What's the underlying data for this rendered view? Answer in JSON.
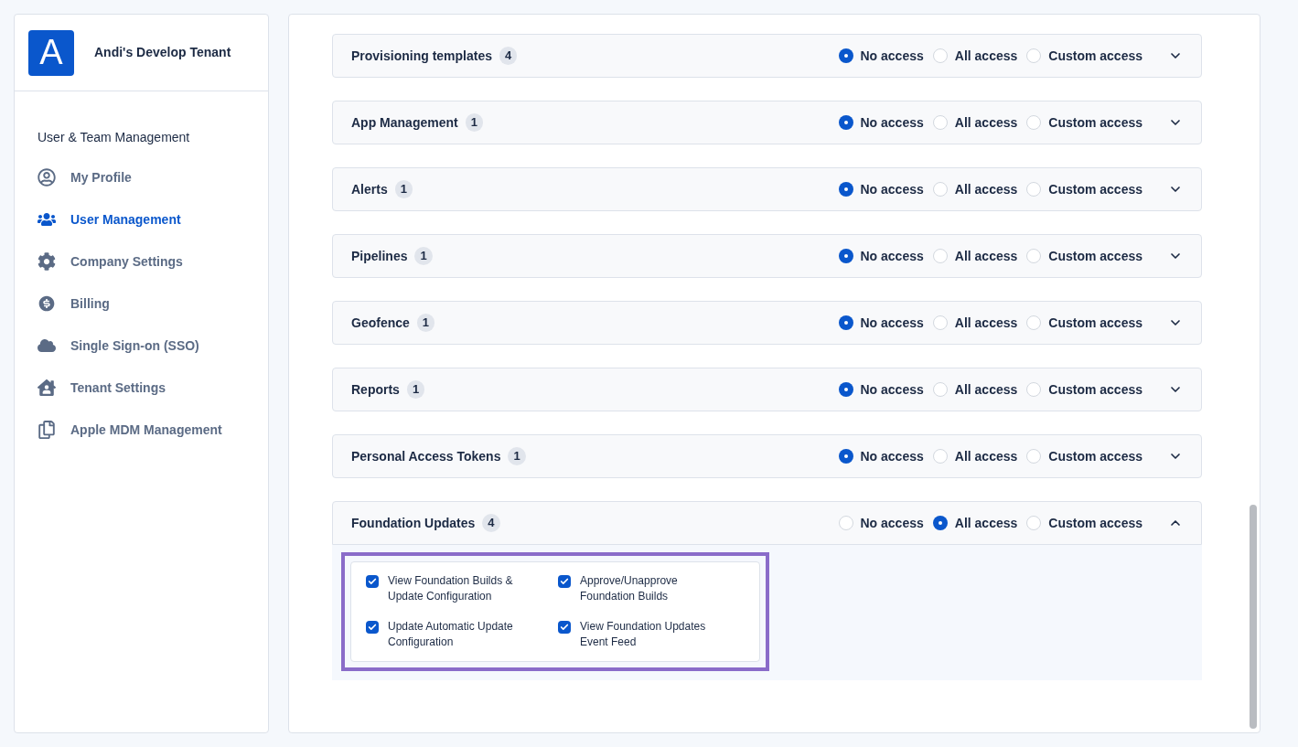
{
  "tenant": {
    "logo_letter": "A",
    "name": "Andi's Develop Tenant"
  },
  "sidebar": {
    "section": "User & Team Management",
    "items": [
      {
        "label": "My Profile",
        "selected": false
      },
      {
        "label": "User Management",
        "selected": true
      },
      {
        "label": "Company Settings",
        "selected": false
      },
      {
        "label": "Billing",
        "selected": false
      },
      {
        "label": "Single Sign-on (SSO)",
        "selected": false
      },
      {
        "label": "Tenant Settings",
        "selected": false
      },
      {
        "label": "Apple MDM Management",
        "selected": false
      }
    ]
  },
  "permissions": [
    {
      "name": "Provisioning templates",
      "count": "4",
      "expanded": false,
      "options": [
        {
          "label": "No access",
          "selected": true
        },
        {
          "label": "All access",
          "selected": false
        },
        {
          "label": "Custom access",
          "selected": false
        }
      ]
    },
    {
      "name": "App Management",
      "count": "1",
      "expanded": false,
      "options": [
        {
          "label": "No access",
          "selected": true
        },
        {
          "label": "All access",
          "selected": false
        },
        {
          "label": "Custom access",
          "selected": false
        }
      ]
    },
    {
      "name": "Alerts",
      "count": "1",
      "expanded": false,
      "options": [
        {
          "label": "No access",
          "selected": true
        },
        {
          "label": "All access",
          "selected": false
        },
        {
          "label": "Custom access",
          "selected": false
        }
      ]
    },
    {
      "name": "Pipelines",
      "count": "1",
      "expanded": false,
      "options": [
        {
          "label": "No access",
          "selected": true
        },
        {
          "label": "All access",
          "selected": false
        },
        {
          "label": "Custom access",
          "selected": false
        }
      ]
    },
    {
      "name": "Geofence",
      "count": "1",
      "expanded": false,
      "options": [
        {
          "label": "No access",
          "selected": true
        },
        {
          "label": "All access",
          "selected": false
        },
        {
          "label": "Custom access",
          "selected": false
        }
      ]
    },
    {
      "name": "Reports",
      "count": "1",
      "expanded": false,
      "options": [
        {
          "label": "No access",
          "selected": true
        },
        {
          "label": "All access",
          "selected": false
        },
        {
          "label": "Custom access",
          "selected": false
        }
      ]
    },
    {
      "name": "Personal Access Tokens",
      "count": "1",
      "expanded": false,
      "options": [
        {
          "label": "No access",
          "selected": true
        },
        {
          "label": "All access",
          "selected": false
        },
        {
          "label": "Custom access",
          "selected": false
        }
      ]
    },
    {
      "name": "Foundation Updates",
      "count": "4",
      "expanded": true,
      "highlighted": true,
      "options": [
        {
          "label": "No access",
          "selected": false
        },
        {
          "label": "All access",
          "selected": true
        },
        {
          "label": "Custom access",
          "selected": false
        }
      ],
      "scopes": [
        {
          "label": "View Foundation Builds & Update Configuration",
          "checked": true
        },
        {
          "label": "Approve/Unapprove Foundation Builds",
          "checked": true
        },
        {
          "label": "Update Automatic Update Configuration",
          "checked": true
        },
        {
          "label": "View Foundation Updates Event Feed",
          "checked": true
        }
      ]
    }
  ]
}
